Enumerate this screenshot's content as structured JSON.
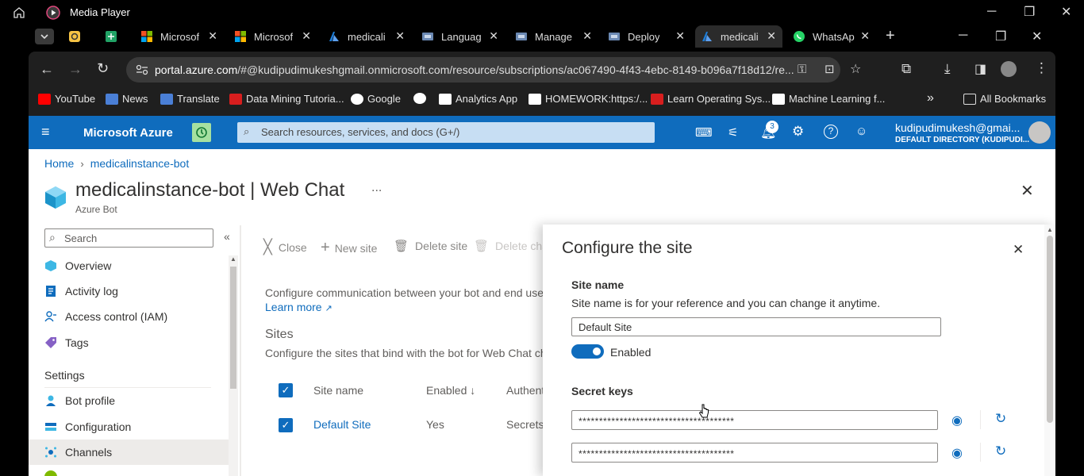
{
  "media_player": {
    "title": "Media Player"
  },
  "tabs": [
    {
      "label": "",
      "icon": "yellow-app-icon"
    },
    {
      "label": "",
      "icon": "sheets-icon"
    },
    {
      "label": "Microsof",
      "icon": "microsoft-icon"
    },
    {
      "label": "Microsof",
      "icon": "microsoft-icon"
    },
    {
      "label": "medicali",
      "icon": "azure-icon"
    },
    {
      "label": "Languag",
      "icon": "page-icon"
    },
    {
      "label": "Manage",
      "icon": "page-icon"
    },
    {
      "label": "Deploy",
      "icon": "page-icon"
    },
    {
      "label": "medicali",
      "icon": "azure-icon",
      "active": true
    },
    {
      "label": "WhatsAp",
      "icon": "whatsapp-icon"
    }
  ],
  "address": {
    "domain": "portal.azure.com",
    "path": "/#@kudipudimukeshgmail.onmicrosoft.com/resource/subscriptions/ac067490-4f43-4ebc-8149-b096a7f18d12/re..."
  },
  "bookmarks": [
    {
      "label": "YouTube",
      "color": "#ff0000"
    },
    {
      "label": "News",
      "color": "#4a7fd6"
    },
    {
      "label": "Translate",
      "color": "#4a7fd6"
    },
    {
      "label": "Data Mining Tutoria...",
      "color": "#d81e1e"
    },
    {
      "label": "Google",
      "color": "#ffffff"
    },
    {
      "label": "",
      "color": "#ffffff"
    },
    {
      "label": "Analytics App",
      "color": "#ffffff"
    },
    {
      "label": "HOMEWORK:https:/...",
      "color": "#ffffff"
    },
    {
      "label": "Learn Operating Sys...",
      "color": "#d81e1e"
    },
    {
      "label": "Machine Learning f...",
      "color": "#ffffff"
    }
  ],
  "all_bookmarks": "All Bookmarks",
  "azure": {
    "brand": "Microsoft Azure",
    "search_placeholder": "Search resources, services, and docs (G+/)",
    "notification_count": "3",
    "user_email": "kudipudimukesh@gmai...",
    "user_directory": "DEFAULT DIRECTORY (KUDIPUDI..."
  },
  "breadcrumb": {
    "home": "Home",
    "current": "medicalinstance-bot"
  },
  "page": {
    "title": "medicalinstance-bot | Web Chat",
    "subtitle": "Azure Bot",
    "more": "..."
  },
  "sidebar": {
    "search_placeholder": "Search",
    "items": [
      "Overview",
      "Activity log",
      "Access control (IAM)",
      "Tags"
    ],
    "section": "Settings",
    "settings_items": [
      "Bot profile",
      "Configuration",
      "Channels"
    ]
  },
  "toolbar": {
    "close": "Close",
    "new_site": "New site",
    "delete_site": "Delete site",
    "delete_channel": "Delete cha"
  },
  "main": {
    "description": "Configure communication between your bot and end users v",
    "learn_more": "Learn more",
    "sites_heading": "Sites",
    "sites_desc": "Configure the sites that bind with the bot for Web Chat chan",
    "table_headers": [
      "Site name",
      "Enabled ↓",
      "Authent"
    ],
    "rows": [
      {
        "site": "Default Site",
        "enabled": "Yes",
        "auth": "Secrets"
      }
    ]
  },
  "flyout": {
    "title": "Configure the site",
    "site_name_label": "Site name",
    "site_name_help": "Site name is for your reference and you can change it anytime.",
    "site_name_value": "Default Site",
    "enabled_label": "Enabled",
    "enabled": true,
    "secret_keys_label": "Secret keys",
    "key1": "**************************************",
    "key2": "**************************************"
  }
}
